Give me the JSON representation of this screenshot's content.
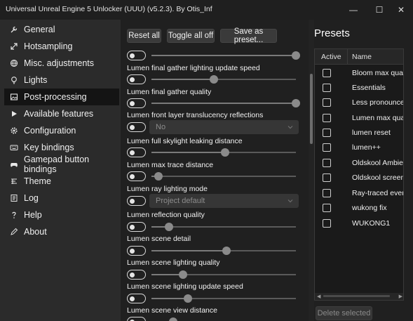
{
  "window": {
    "title": "Universal Unreal Engine 5 Unlocker (UUU) (v5.2.3). By Otis_Inf",
    "minimize": "—",
    "maximize": "☐",
    "close": "✕"
  },
  "sidebar": {
    "items": [
      {
        "label": "General",
        "icon": "wrench-icon"
      },
      {
        "label": "Hotsampling",
        "icon": "resize-arrows-icon"
      },
      {
        "label": "Misc. adjustments",
        "icon": "globe-icon"
      },
      {
        "label": "Lights",
        "icon": "lightbulb-icon"
      },
      {
        "label": "Post-processing",
        "icon": "image-icon"
      },
      {
        "label": "Available features",
        "icon": "play-icon"
      },
      {
        "label": "Configuration",
        "icon": "gear-icon"
      },
      {
        "label": "Key bindings",
        "icon": "keyboard-icon"
      },
      {
        "label": "Gamepad button bindings",
        "icon": "gamepad-icon"
      },
      {
        "label": "Theme",
        "icon": "theme-icon"
      },
      {
        "label": "Log",
        "icon": "log-icon"
      },
      {
        "label": "Help",
        "icon": "help-icon"
      },
      {
        "label": "About",
        "icon": "pen-icon"
      }
    ],
    "active": "Post-processing"
  },
  "toolbar": {
    "reset_all": "Reset all",
    "toggle_all_off": "Toggle all off",
    "save_as_preset": "Save as preset..."
  },
  "settings": {
    "s0": {
      "level": 1.0
    },
    "s1": {
      "label": "Lumen final gather lighting update speed",
      "level": 0.43
    },
    "s2": {
      "label": "Lumen final gather quality",
      "level": 1.0
    },
    "s3": {
      "label": "Lumen front layer translucency reflections",
      "value": "No"
    },
    "s4": {
      "label": "Lumen full skylight leaking distance",
      "level": 0.51
    },
    "s5": {
      "label": "Lumen max trace distance",
      "level": 0.05
    },
    "s6": {
      "label": "Lumen ray lighting mode",
      "value": "Project default"
    },
    "s7": {
      "label": "Lumen reflection quality",
      "level": 0.12
    },
    "s8": {
      "label": "Lumen scene detail",
      "level": 0.52
    },
    "s9": {
      "label": "Lumen scene lighting quality",
      "level": 0.22
    },
    "s10": {
      "label": "Lumen scene lighting update speed",
      "level": 0.25
    },
    "s11": {
      "label": "Lumen scene view distance",
      "level": 0.15
    }
  },
  "presets": {
    "title": "Presets",
    "col_active": "Active",
    "col_name": "Name",
    "rows": [
      "Bloom max qual",
      "Essentials",
      "Less pronouncec",
      "Lumen max qual",
      "lumen reset",
      "lumen++",
      "Oldskool Ambie",
      "Oldskool screen",
      "Ray-traced every",
      "wukong fix",
      "WUKONG1"
    ],
    "delete_selected": "Delete selected",
    "scroll_left": "◀",
    "scroll_right": "▶"
  },
  "colors": {
    "background": "#202020",
    "sidebar": "#2b2b2b",
    "active_item": "#141414"
  }
}
